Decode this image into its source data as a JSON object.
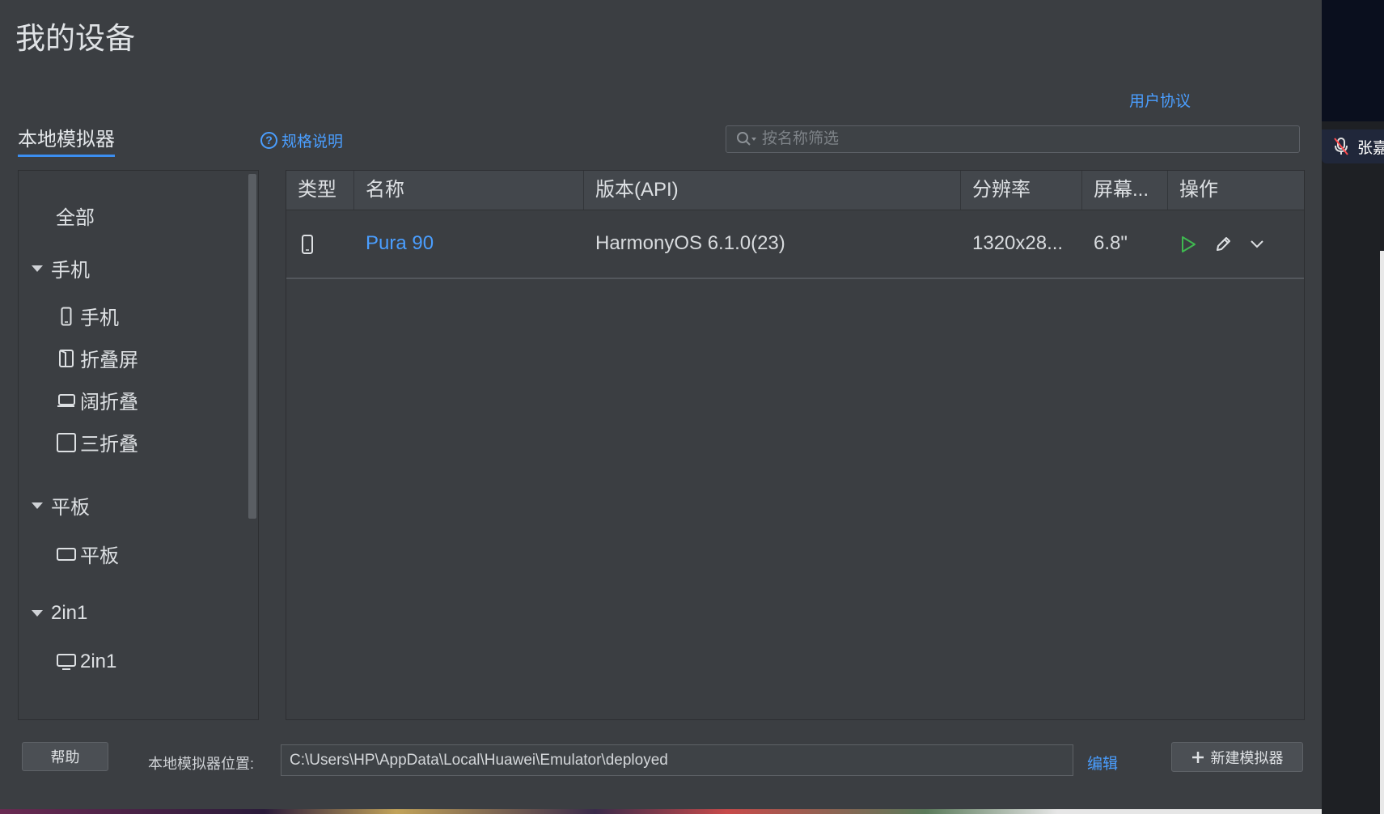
{
  "header": {
    "title": "我的设备",
    "user_agreement": "用户协议"
  },
  "tabs": [
    {
      "label": "本地模拟器",
      "active": true
    }
  ],
  "spec_link": {
    "label": "规格说明",
    "icon": "help-circle-icon"
  },
  "search": {
    "placeholder": "按名称筛选",
    "value": ""
  },
  "sidebar": {
    "all": "全部",
    "groups": [
      {
        "label": "手机",
        "items": [
          {
            "label": "手机",
            "icon": "phone-icon"
          },
          {
            "label": "折叠屏",
            "icon": "foldable-icon"
          },
          {
            "label": "阔折叠",
            "icon": "wide-fold-icon"
          },
          {
            "label": "三折叠",
            "icon": "tri-fold-icon"
          }
        ]
      },
      {
        "label": "平板",
        "items": [
          {
            "label": "平板",
            "icon": "tablet-icon"
          }
        ]
      },
      {
        "label": "2in1",
        "items": [
          {
            "label": "2in1",
            "icon": "monitor-icon"
          }
        ]
      }
    ]
  },
  "table": {
    "columns": [
      "类型",
      "名称",
      "版本(API)",
      "分辨率",
      "屏幕...",
      "操作"
    ],
    "rows": [
      {
        "type_icon": "phone-icon",
        "name": "Pura 90",
        "version": "HarmonyOS 6.1.0(23)",
        "resolution": "1320x28...",
        "screen": "6.8\""
      }
    ]
  },
  "footer": {
    "help": "帮助",
    "location_label": "本地模拟器位置:",
    "location_value": "C:\\Users\\HP\\AppData\\Local\\Huawei\\Emulator\\deployed",
    "edit": "编辑",
    "new_emulator": "新建模拟器"
  },
  "overlay": {
    "name": "张嘉"
  },
  "colors": {
    "accent": "#4a9eff",
    "play": "#3fb950",
    "background": "#3b3e42"
  }
}
